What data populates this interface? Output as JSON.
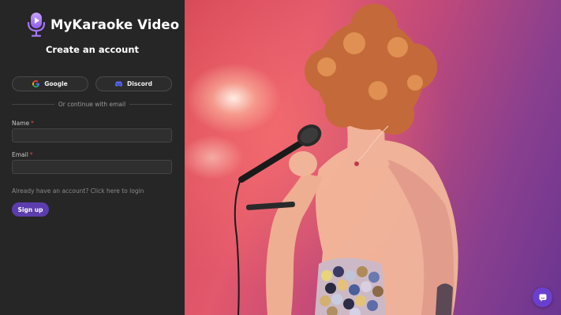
{
  "brand": {
    "name": "MyKaraoke Video",
    "logo_icon": "microphone-play-icon",
    "accent": "#b987f5"
  },
  "form": {
    "title": "Create an account",
    "oauth": [
      {
        "label": "Google",
        "icon": "google-icon"
      },
      {
        "label": "Discord",
        "icon": "discord-icon"
      }
    ],
    "divider_text": "Or continue with email",
    "fields": [
      {
        "label": "Name",
        "required_mark": "*",
        "value": "",
        "placeholder": ""
      },
      {
        "label": "Email",
        "required_mark": "*",
        "value": "",
        "placeholder": ""
      }
    ],
    "login_link": "Already have an account? Click here to login",
    "submit_label": "Sign up"
  },
  "hero": {
    "subject": "singer-photo"
  },
  "chat": {
    "icon": "chat-icon"
  },
  "colors": {
    "panel_bg": "#262626",
    "primary": "#5c3dad",
    "chat": "#6a3fd0",
    "required": "#e04848"
  }
}
